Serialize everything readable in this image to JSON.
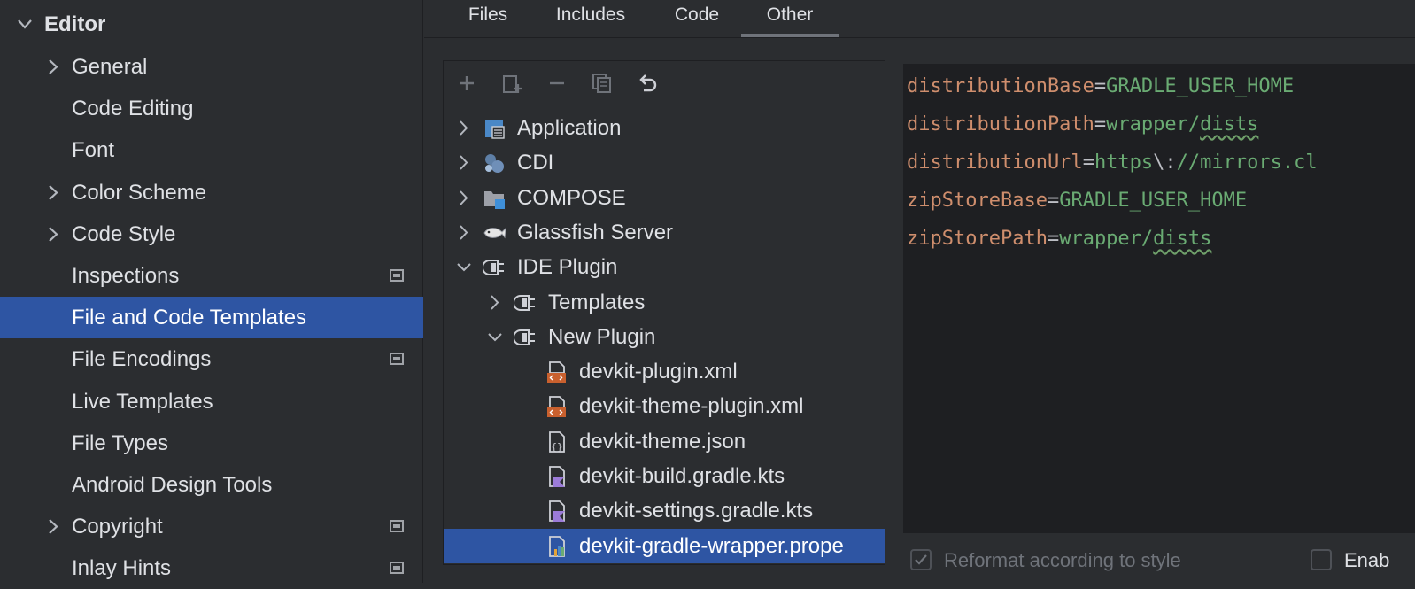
{
  "sidebar": {
    "header": "Editor",
    "items": [
      {
        "label": "General",
        "expandable": true,
        "badge": false
      },
      {
        "label": "Code Editing",
        "expandable": false,
        "badge": false
      },
      {
        "label": "Font",
        "expandable": false,
        "badge": false
      },
      {
        "label": "Color Scheme",
        "expandable": true,
        "badge": false
      },
      {
        "label": "Code Style",
        "expandable": true,
        "badge": false
      },
      {
        "label": "Inspections",
        "expandable": false,
        "badge": true
      },
      {
        "label": "File and Code Templates",
        "expandable": false,
        "badge": false,
        "selected": true
      },
      {
        "label": "File Encodings",
        "expandable": false,
        "badge": true
      },
      {
        "label": "Live Templates",
        "expandable": false,
        "badge": false
      },
      {
        "label": "File Types",
        "expandable": false,
        "badge": false
      },
      {
        "label": "Android Design Tools",
        "expandable": false,
        "badge": false
      },
      {
        "label": "Copyright",
        "expandable": true,
        "badge": true
      },
      {
        "label": "Inlay Hints",
        "expandable": false,
        "badge": true
      }
    ]
  },
  "tabs": [
    {
      "label": "Files"
    },
    {
      "label": "Includes"
    },
    {
      "label": "Code"
    },
    {
      "label": "Other",
      "active": true
    }
  ],
  "toolbar": {
    "icons": [
      "add-icon",
      "add-child-icon",
      "remove-icon",
      "copy-icon",
      "reset-icon"
    ]
  },
  "tree": [
    {
      "label": "Application",
      "icon": "application-icon",
      "state": "collapsed"
    },
    {
      "label": "CDI",
      "icon": "cdi-icon",
      "state": "collapsed"
    },
    {
      "label": "COMPOSE",
      "icon": "folder-icon",
      "state": "collapsed"
    },
    {
      "label": "Glassfish Server",
      "icon": "glassfish-icon",
      "state": "collapsed"
    },
    {
      "label": "IDE Plugin",
      "icon": "plugin-icon",
      "state": "expanded"
    },
    {
      "label": "Templates",
      "icon": "plugin-icon",
      "state": "collapsed"
    },
    {
      "label": "New Plugin",
      "icon": "plugin-icon",
      "state": "expanded"
    },
    {
      "label": "devkit-plugin.xml",
      "icon": "xml-file-icon"
    },
    {
      "label": "devkit-theme-plugin.xml",
      "icon": "xml-file-icon"
    },
    {
      "label": "devkit-theme.json",
      "icon": "json-file-icon"
    },
    {
      "label": "devkit-build.gradle.kts",
      "icon": "kotlin-file-icon"
    },
    {
      "label": "devkit-settings.gradle.kts",
      "icon": "kotlin-file-icon"
    },
    {
      "label": "devkit-gradle-wrapper.prope",
      "icon": "properties-file-icon",
      "selected": true
    }
  ],
  "code": [
    {
      "key": "distributionBase",
      "eq": "=",
      "value": "GRADLE_USER_HOME"
    },
    {
      "key": "distributionPath",
      "eq": "=",
      "value": "wrapper/",
      "value2": "dists"
    },
    {
      "key": "distributionUrl",
      "eq": "=",
      "value": "https",
      "esc": "\\:",
      "value2": "//mirrors.cl"
    },
    {
      "key": "zipStoreBase",
      "eq": "=",
      "value": "GRADLE_USER_HOME"
    },
    {
      "key": "zipStorePath",
      "eq": "=",
      "value": "wrapper/",
      "value2": "dists"
    }
  ],
  "options": {
    "reformat_label": "Reformat according to style",
    "reformat_checked": true,
    "enable_label": "Enab",
    "enable_checked": false
  },
  "colors": {
    "selection": "#2e55a3",
    "key": "#cf8e6d",
    "value": "#6aab73",
    "background": "#2b2d30",
    "editor_background": "#1e1f22"
  }
}
